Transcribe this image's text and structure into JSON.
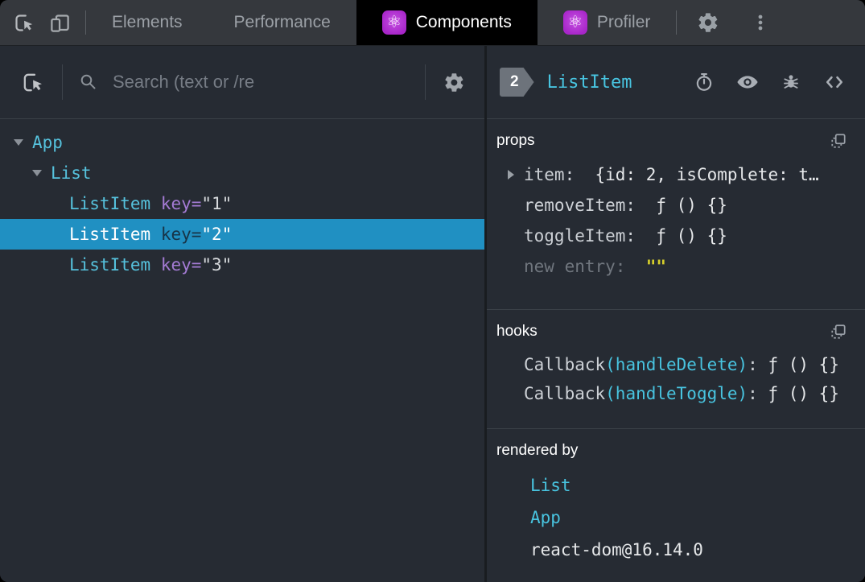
{
  "topbar": {
    "tabs": [
      {
        "label": "Elements",
        "active": false,
        "icon": null
      },
      {
        "label": "Performance",
        "active": false,
        "icon": null
      },
      {
        "label": "Components",
        "active": true,
        "icon": "react-atom"
      },
      {
        "label": "Profiler",
        "active": false,
        "icon": "react-atom"
      }
    ]
  },
  "left_panel": {
    "search": {
      "placeholder": "Search (text or /re"
    },
    "tree": [
      {
        "name": "App",
        "depth": 0,
        "expanded": true,
        "selected": false,
        "attr_name": null,
        "attr_value": null
      },
      {
        "name": "List",
        "depth": 1,
        "expanded": true,
        "selected": false,
        "attr_name": null,
        "attr_value": null
      },
      {
        "name": "ListItem",
        "depth": 2,
        "expanded": null,
        "selected": false,
        "attr_name": "key",
        "attr_value": "\"1\""
      },
      {
        "name": "ListItem",
        "depth": 2,
        "expanded": null,
        "selected": true,
        "attr_name": "key",
        "attr_value": "\"2\""
      },
      {
        "name": "ListItem",
        "depth": 2,
        "expanded": null,
        "selected": false,
        "attr_name": "key",
        "attr_value": "\"3\""
      }
    ]
  },
  "right_panel": {
    "owner_badge": "2",
    "selected_component": "ListItem",
    "props": {
      "label": "props",
      "rows": [
        {
          "key": "item",
          "value": "{id: 2, isComplete: t…",
          "expandable": true,
          "new_entry": false
        },
        {
          "key": "removeItem",
          "value": "ƒ () {}",
          "expandable": false,
          "new_entry": false
        },
        {
          "key": "toggleItem",
          "value": "ƒ () {}",
          "expandable": false,
          "new_entry": false
        },
        {
          "key": "new entry",
          "value": "\"\"",
          "expandable": false,
          "new_entry": true
        }
      ]
    },
    "hooks": {
      "label": "hooks",
      "rows": [
        {
          "hook_type": "Callback",
          "hook_name": "(handleDelete)",
          "value": "ƒ () {}"
        },
        {
          "hook_type": "Callback",
          "hook_name": "(handleToggle)",
          "value": "ƒ () {}"
        }
      ]
    },
    "rendered_by": {
      "label": "rendered by",
      "rows": [
        {
          "text": "List",
          "link": true
        },
        {
          "text": "App",
          "link": true
        },
        {
          "text": "react-dom@16.14.0",
          "link": false
        }
      ]
    }
  },
  "colors": {
    "accent_cyan": "#48c4e0",
    "selected_row_bg": "#2090c2",
    "attr_purple": "#a47bd4",
    "new_entry_yellow": "#d6cf2b",
    "react_chip_purple": "#b136d0",
    "active_tab_bg": "#000000",
    "panel_bg": "#262b33",
    "topbar_bg": "#35383d"
  }
}
